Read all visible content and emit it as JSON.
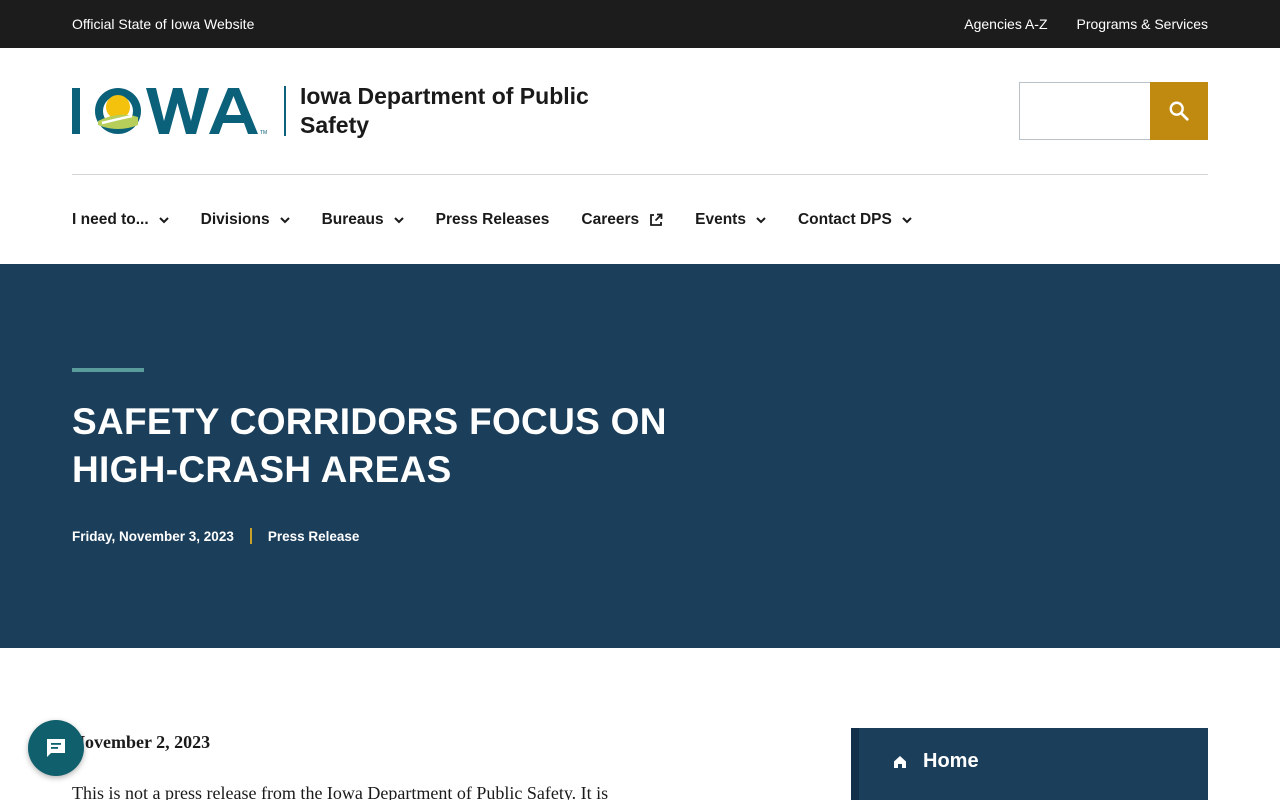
{
  "topbar": {
    "official_label": "Official State of Iowa Website",
    "links": [
      "Agencies A-Z",
      "Programs & Services"
    ]
  },
  "header": {
    "logo_text": "IOWA",
    "department_name": "Iowa Department of Public Safety",
    "search": {
      "value": "",
      "icon": "search-icon"
    }
  },
  "nav": {
    "items": [
      {
        "label": "I need to...",
        "icon": "chevron-down-icon"
      },
      {
        "label": "Divisions",
        "icon": "chevron-down-icon"
      },
      {
        "label": "Bureaus",
        "icon": "chevron-down-icon"
      },
      {
        "label": "Press Releases",
        "icon": ""
      },
      {
        "label": "Careers",
        "icon": "external-link-icon"
      },
      {
        "label": "Events",
        "icon": "chevron-down-icon"
      },
      {
        "label": "Contact DPS",
        "icon": "chevron-down-icon"
      }
    ]
  },
  "hero": {
    "title": "SAFETY CORRIDORS FOCUS ON HIGH-CRASH AREAS",
    "date": "Friday, November 3, 2023",
    "type": "Press Release"
  },
  "article": {
    "date": "November 2, 2023",
    "body": "This is not a press release from the Iowa Department of Public Safety. It is"
  },
  "sidebar": {
    "home_label": "Home",
    "home_icon": "home-icon"
  },
  "chat": {
    "icon": "chat-icon"
  },
  "colors": {
    "topbar": "#1c1c1c",
    "hero": "#1b3e5a",
    "search_button": "#c08a10",
    "accent_teal": "#5a9c9b",
    "meta_separator": "#c9a227",
    "logo_blue": "#0b6179",
    "chat_button": "#0f5f6d"
  }
}
